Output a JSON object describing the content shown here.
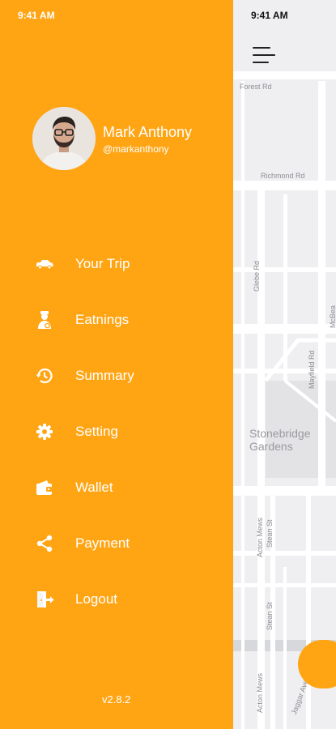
{
  "drawer": {
    "status_time": "9:41 AM",
    "profile": {
      "name": "Mark Anthony",
      "handle": "@markanthony"
    },
    "menu": [
      {
        "label": "Your Trip",
        "icon": "car-icon"
      },
      {
        "label": "Eatnings",
        "icon": "driver-icon"
      },
      {
        "label": "Summary",
        "icon": "history-icon"
      },
      {
        "label": "Setting",
        "icon": "gear-icon"
      },
      {
        "label": "Wallet",
        "icon": "wallet-icon"
      },
      {
        "label": "Payment",
        "icon": "share-icon"
      },
      {
        "label": "Logout",
        "icon": "logout-icon"
      }
    ],
    "version": "v2.8.2"
  },
  "map": {
    "status_time": "9:41 AM",
    "streets": {
      "forest": "Forest Rd",
      "richmond": "Richmond Rd",
      "glebe": "Glebe Rd",
      "mayfield": "Mayfield Rd",
      "mcbea": "McBea",
      "acton": "Acton Mews",
      "stean": "Stean St",
      "stean2": "Stean St",
      "acton2": "Acton Mews",
      "jaggar": "Jaggar Ave"
    },
    "area_line1": "Stonebridge",
    "area_line2": "Gardens"
  },
  "colors": {
    "accent": "#ffa514",
    "map_bg": "#efeff1",
    "road": "#ffffff"
  }
}
